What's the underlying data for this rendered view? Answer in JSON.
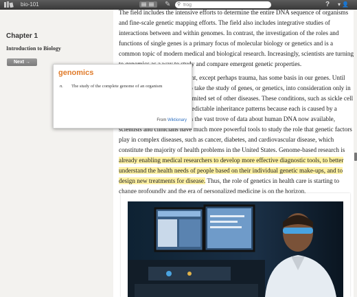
{
  "toolbar": {
    "library_icon": "books-icon",
    "title": "bio-101",
    "view_icon": "list-view-icon",
    "pencil_icon": "pencil-icon",
    "search_value": "frog",
    "help_label": "?",
    "user_label": "▾ 👤"
  },
  "nav": {
    "chapter": "Chapter 1",
    "chapter_title": "Introduction to Biology",
    "next_label": "Next  →"
  },
  "content": {
    "p1": "The field includes the intensive efforts to determine the entire DNA sequence of organisms and fine-scale genetic mapping efforts. The field also includes integrative studies of interactions between and within genomes. In contrast, the investigation of the roles and functions of single genes is a primary focus of molecular biology or genetics and is a common topic of modern medical and biological research. Increasingly, scientists are turning to genomics as a way to study and compare emergent genetic properties.",
    "p2_before": "Virtually every human ailment, except perhaps trauma, has some basis in our genes. Until recently, doctors were able to take the study of genes, or genetics, into consideration only in cases of birth defects and a limited set of other diseases. These conditions, such as sickle cell anemia, have very simple, predictable inheritance patterns because each is caused by a change in a single gene. With the vast trove of data about human DNA now available, scientists and clinicians have much more powerful tools to study the role that genetic factors play in complex diseases, such as cancer, diabetes, and cardiovascular disease, which constitute the majority of health problems in the United States. Genome-based research is ",
    "p2_highlight": "already enabling medical researchers to develop more effective diagnostic tools, to better understand the health needs of people based on their individual genetic make-ups, and to design new treatments for disease.",
    "p2_after": " Thus, the role of genetics in health care is starting to change profoundly and the era of personalized medicine is on the horizon."
  },
  "popup": {
    "word": "genomics",
    "pos": "n.",
    "definition": "The study of the complete genome of an organism",
    "source_prefix": "From ",
    "source_link": "Wiktionary"
  },
  "colors": {
    "accent": "#e07b2a",
    "highlight": "#fdf1a4",
    "link": "#2b6dbf"
  }
}
